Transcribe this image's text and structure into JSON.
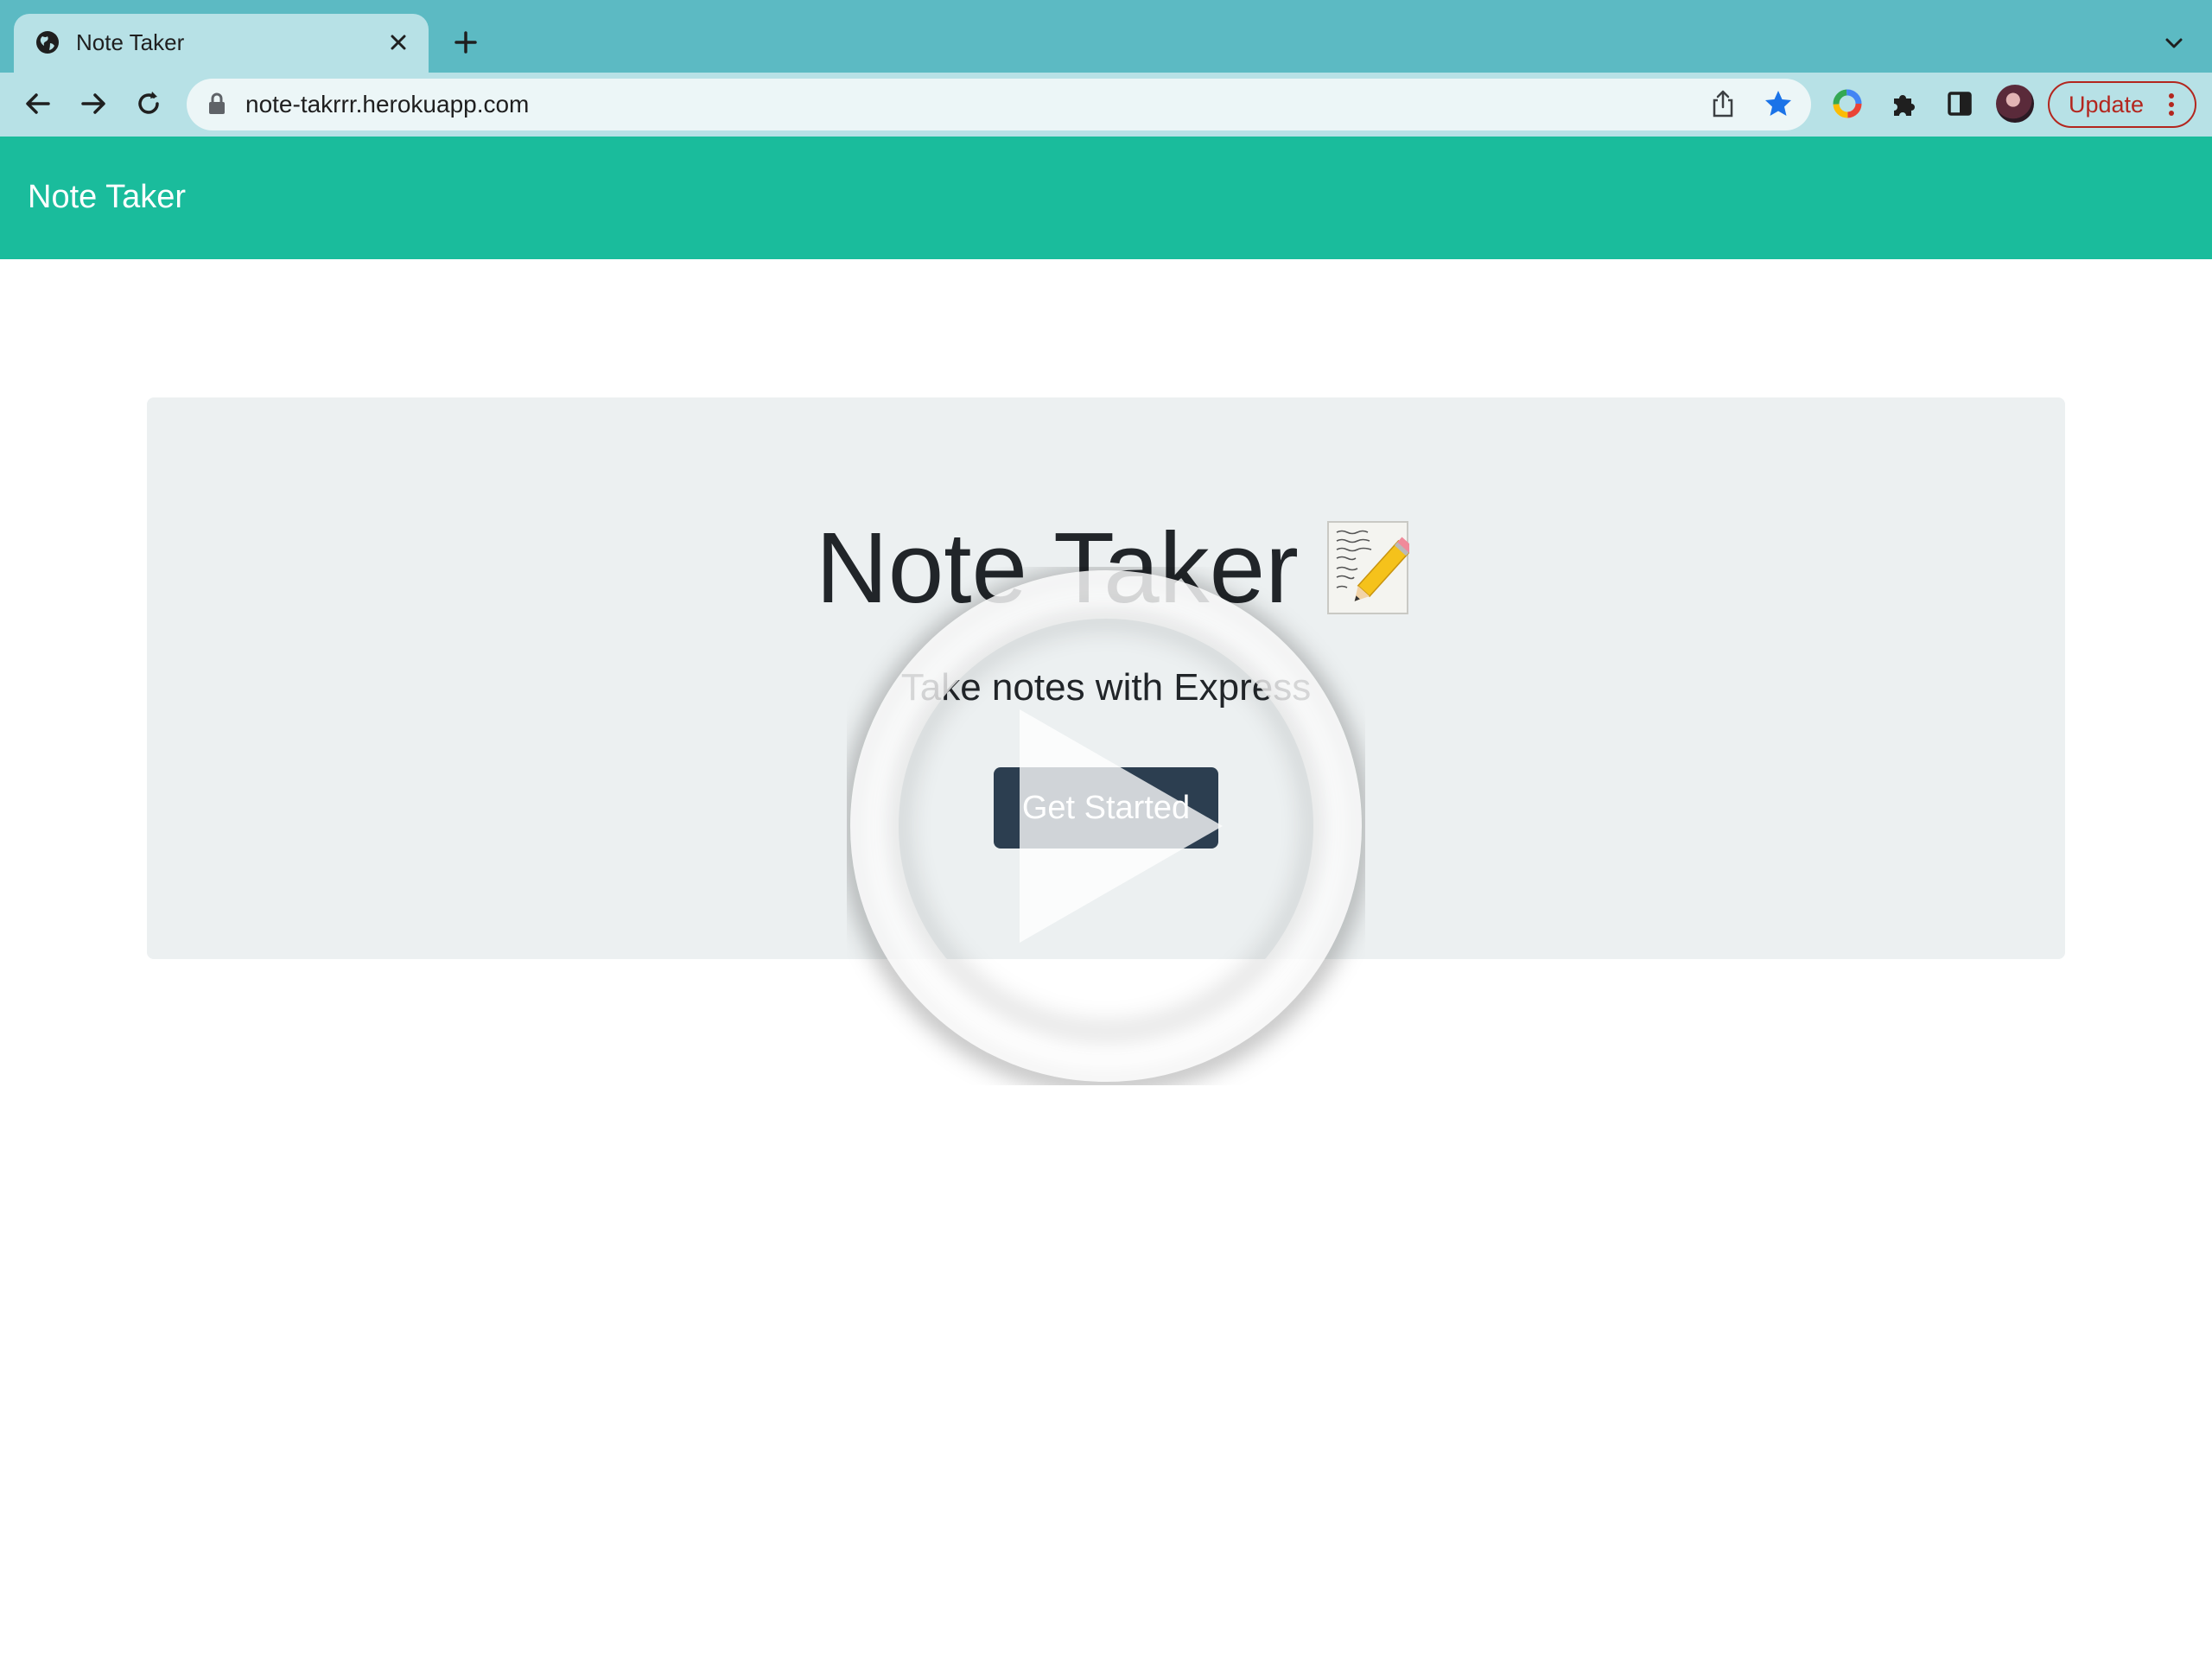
{
  "browser": {
    "tab": {
      "title": "Note Taker",
      "favicon": "globe-icon",
      "close": "close-icon"
    },
    "new_tab": "plus-icon",
    "tab_search": "chevron-down-icon",
    "nav": {
      "back": "arrow-left-icon",
      "forward": "arrow-right-icon",
      "reload": "reload-icon"
    },
    "address": {
      "url": "note-takrrr.herokuapp.com",
      "lock": "lock-icon",
      "share": "share-icon",
      "bookmark": "star-icon"
    },
    "extensions": [
      "color-wheel-icon",
      "puzzle-icon",
      "side-panel-icon"
    ],
    "profile": "avatar",
    "update_label": "Update",
    "menu": "kebab-menu-icon"
  },
  "app": {
    "brand": "Note Taker",
    "hero": {
      "title": "Note Taker",
      "icon": "memo-icon",
      "subtitle": "Take notes with Express",
      "cta_label": "Get Started"
    },
    "overlay": "play-icon"
  },
  "colors": {
    "tabstrip": "#5cbac3",
    "toolbar": "#b7e1e6",
    "navbar": "#1abc9c",
    "jumbotron": "#ecf0f1",
    "button": "#2c3e50",
    "update": "#b3261e"
  }
}
